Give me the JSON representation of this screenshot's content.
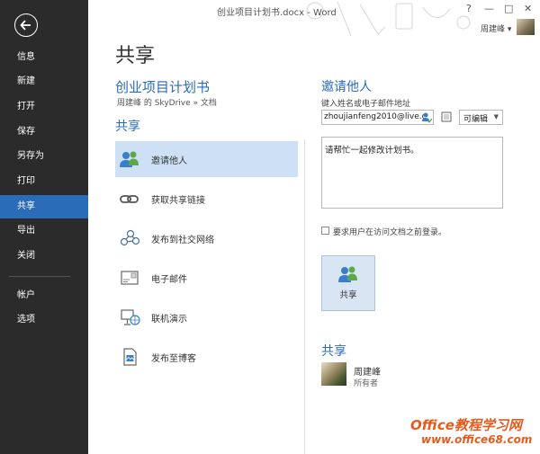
{
  "window": {
    "title": "创业项目计划书.docx - Word",
    "help": "?",
    "minimize": "—",
    "maximize": "□",
    "close": "✕"
  },
  "user": {
    "name": "周建峰",
    "menu_caret": "▾"
  },
  "sidebar": {
    "items": [
      {
        "label": "信息"
      },
      {
        "label": "新建"
      },
      {
        "label": "打开"
      },
      {
        "label": "保存"
      },
      {
        "label": "另存为"
      },
      {
        "label": "打印"
      },
      {
        "label": "共享",
        "active": true
      },
      {
        "label": "导出"
      },
      {
        "label": "关闭"
      },
      {
        "label": "帐户"
      },
      {
        "label": "选项"
      }
    ]
  },
  "page": {
    "title": "共享"
  },
  "document": {
    "title": "创业项目计划书",
    "path": "周建峰 的 SkyDrive » 文档"
  },
  "share_section": {
    "heading": "共享",
    "options": [
      {
        "label": "邀请他人",
        "icon": "people-icon",
        "active": true
      },
      {
        "label": "获取共享链接",
        "icon": "link-icon"
      },
      {
        "label": "发布到社交网络",
        "icon": "social-network-icon"
      },
      {
        "label": "电子邮件",
        "icon": "email-icon"
      },
      {
        "label": "联机演示",
        "icon": "present-online-icon"
      },
      {
        "label": "发布至博客",
        "icon": "blog-icon"
      }
    ]
  },
  "invite": {
    "heading": "邀请他人",
    "sublabel": "键入姓名或电子邮件地址",
    "email_value": "zhoujianfeng2010@live.c",
    "permission": "可编辑",
    "message": "请帮忙一起修改计划书。",
    "require_signin_label": "要求用户在访问文档之前登录。",
    "require_signin_checked": false,
    "share_button_label": "共享"
  },
  "shared_with": {
    "heading": "共享",
    "owner_name": "周建峰",
    "owner_role": "所有者"
  },
  "watermark": {
    "main": "Office教程学习网",
    "url": "www.office68.com"
  },
  "colors": {
    "accent": "#2b6cb8",
    "sidebar_bg": "#2b2b2b",
    "selected_bg": "#cde0f5",
    "watermark": "#e85a1c"
  }
}
